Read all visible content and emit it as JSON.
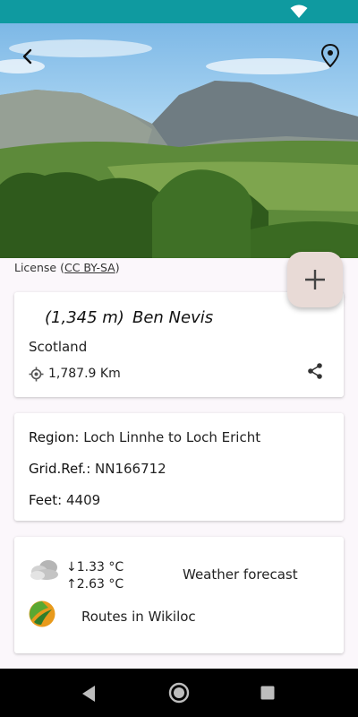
{
  "hero": {
    "back_icon": "back-arrow-icon",
    "map_icon": "map-pin-icon"
  },
  "license": {
    "prefix": "License (",
    "link": "CC BY-SA",
    "suffix": ")"
  },
  "fab": {
    "icon": "plus-icon"
  },
  "summary": {
    "elevation": "(1,345 m)",
    "name": "Ben Nevis",
    "country": "Scotland",
    "distance": "1,787.9 Km",
    "share_icon": "share-icon"
  },
  "details": {
    "region_label": "Region",
    "region_value": "Loch Linnhe to Loch Ericht",
    "gridref_label": "Grid.Ref.",
    "gridref_value": "NN166712",
    "feet_label": "Feet",
    "feet_value": "4409"
  },
  "weather": {
    "temp_min": "↓1.33 °C",
    "temp_max": "↑2.63 °C",
    "forecast_label": "Weather forecast",
    "routes_label": "Routes in Wikiloc"
  },
  "colors": {
    "status_bar": "#0f9aa0",
    "fab_bg": "#e8dad6",
    "page_bg": "#fbf7fb"
  }
}
